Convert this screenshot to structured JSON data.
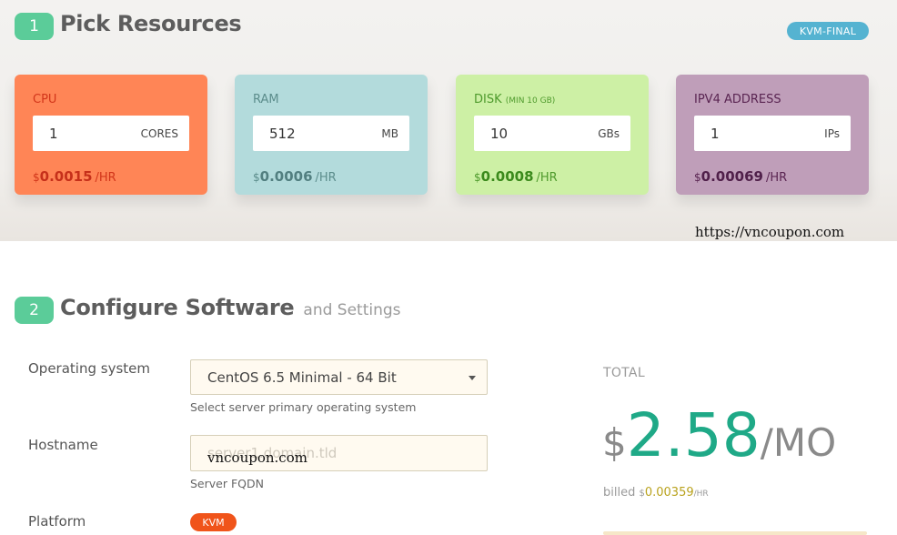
{
  "step1": {
    "number": "1",
    "title": "Pick Resources",
    "plan_tag": "KVM-FINAL"
  },
  "resources": {
    "cpu": {
      "label": "CPU",
      "min_note": "",
      "value": "1",
      "unit": "CORES",
      "currency": "$",
      "price": "0.0015",
      "per": "/HR"
    },
    "ram": {
      "label": "RAM",
      "min_note": "",
      "value": "512",
      "unit": "MB",
      "currency": "$",
      "price": "0.0006",
      "per": "/HR"
    },
    "disk": {
      "label": "DISK",
      "min_note": "(MIN 10 GB)",
      "value": "10",
      "unit": "GBs",
      "currency": "$",
      "price": "0.0008",
      "per": "/HR"
    },
    "ipv4": {
      "label": "IPV4 ADDRESS",
      "min_note": "",
      "value": "1",
      "unit": "IPs",
      "currency": "$",
      "price": "0.00069",
      "per": "/HR"
    }
  },
  "watermark": "https://vncoupon.com",
  "watermark2": "vncoupon.com",
  "step2": {
    "number": "2",
    "title": "Configure Software",
    "subtitle": "and Settings"
  },
  "form": {
    "os": {
      "label": "Operating system",
      "selected": "CentOS 6.5 Minimal - 64 Bit",
      "help": "Select server primary operating system"
    },
    "hostname": {
      "label": "Hostname",
      "placeholder": "server1.domain.tld",
      "help": "Server FQDN"
    },
    "platform": {
      "label": "Platform",
      "tag": "KVM"
    }
  },
  "total": {
    "label": "TOTAL",
    "currency": "$",
    "amount": "2.58",
    "per": "/MO",
    "billed_prefix": "billed",
    "billed_currency": "$",
    "billed_amount": "0.00359",
    "billed_per": "/HR"
  },
  "colors": {
    "step_badge": "#5bcc99",
    "cpu": "#ff8556",
    "ram": "#b3dbdc",
    "disk": "#cdf0a5",
    "ipv4": "#bf9eb9",
    "total_amount": "#1fa987",
    "platform_tag": "#f0541a",
    "plan_tag": "#55b3d1"
  }
}
